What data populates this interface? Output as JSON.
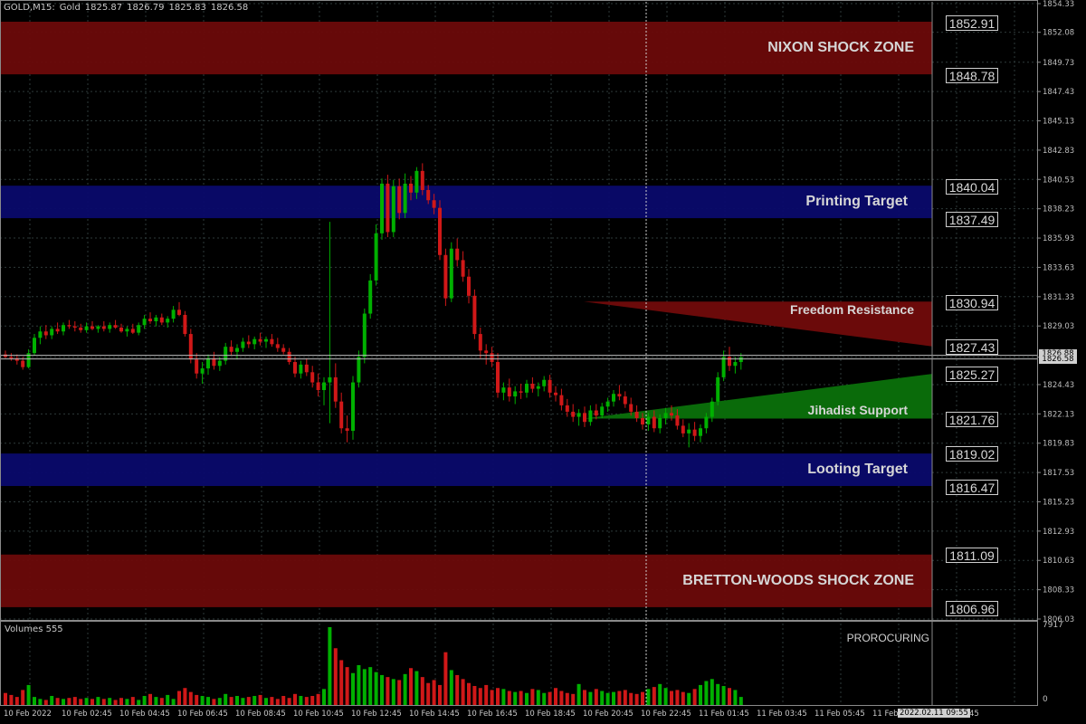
{
  "header": {
    "symbol": "GOLD,M15:",
    "name": "Gold",
    "open": "1825.87",
    "high": "1826.79",
    "low": "1825.83",
    "close": "1826.58"
  },
  "colors": {
    "background": "#000000",
    "grid": "#2e3a3a",
    "bull": "#00b000",
    "bear": "#d01818",
    "red_zone": "#6b0a0a",
    "blue_zone": "#0a0a6b",
    "green_wedge": "#0a6b0a"
  },
  "price_axis": {
    "ticks": [
      "1854.33",
      "1852.08",
      "1849.73",
      "1847.43",
      "1845.13",
      "1842.83",
      "1840.53",
      "1838.23",
      "1835.93",
      "1833.63",
      "1831.33",
      "1829.03",
      "1826.58",
      "1824.43",
      "1822.13",
      "1819.83",
      "1817.53",
      "1815.23",
      "1812.93",
      "1810.63",
      "1808.33",
      "1806.03"
    ],
    "current_price": "1826.58",
    "current_price_hidden": "1826.88"
  },
  "zones": [
    {
      "label": "NIXON SHOCK ZONE",
      "top_level": "1852.91",
      "bottom_level": "1848.78",
      "color": "red"
    },
    {
      "label": "Printing Target",
      "top_level": "1840.04",
      "bottom_level": "1837.49",
      "color": "blue"
    },
    {
      "label": "Looting Target",
      "top_level": "1819.02",
      "bottom_level": "1816.47",
      "color": "blue"
    },
    {
      "label": "BRETTON-WOODS SHOCK ZONE",
      "top_level": "1811.09",
      "bottom_level": "1806.96",
      "color": "red"
    }
  ],
  "wedges": {
    "resistance": {
      "label": "Freedom Resistance",
      "top_level": "1830.94",
      "bottom_level": "1827.43"
    },
    "support": {
      "label": "Jihadist Support",
      "top_level": "1825.27",
      "bottom_level": "1821.76"
    }
  },
  "volume": {
    "title": "Volumes 555",
    "indicator_name": "PROROCURING",
    "max": "7917",
    "min": "0"
  },
  "time_axis": {
    "labels": [
      "10 Feb 2022",
      "10 Feb 02:45",
      "10 Feb 04:45",
      "10 Feb 06:45",
      "10 Feb 08:45",
      "10 Feb 10:45",
      "10 Feb 12:45",
      "10 Feb 14:45",
      "10 Feb 16:45",
      "10 Feb 18:45",
      "10 Feb 20:45",
      "10 Feb 22:45",
      "11 Feb 01:45",
      "11 Feb 03:45",
      "11 Feb 05:45",
      "11 Feb"
    ],
    "current_time": "2022.02.11 09:55",
    "tail": "45"
  },
  "chart_data": {
    "type": "candlestick",
    "symbol": "GOLD",
    "timeframe": "M15",
    "ylim": [
      1806.03,
      1854.33
    ],
    "candles": [
      [
        1826.8,
        1827.1,
        1826.5,
        1826.6
      ],
      [
        1826.6,
        1826.9,
        1826.3,
        1826.5
      ],
      [
        1826.5,
        1826.8,
        1826.0,
        1826.3
      ],
      [
        1826.3,
        1826.6,
        1825.6,
        1825.8
      ],
      [
        1825.8,
        1827.2,
        1825.7,
        1826.9
      ],
      [
        1826.9,
        1828.4,
        1826.7,
        1828.1
      ],
      [
        1828.1,
        1829.0,
        1827.6,
        1828.6
      ],
      [
        1828.6,
        1829.1,
        1828.0,
        1828.3
      ],
      [
        1828.3,
        1829.0,
        1828.0,
        1828.8
      ],
      [
        1828.8,
        1829.3,
        1828.4,
        1828.6
      ],
      [
        1828.6,
        1829.3,
        1828.3,
        1829.1
      ],
      [
        1829.1,
        1829.5,
        1828.8,
        1829.0
      ],
      [
        1829.0,
        1829.4,
        1828.6,
        1828.9
      ],
      [
        1828.9,
        1829.2,
        1828.5,
        1828.7
      ],
      [
        1828.7,
        1829.3,
        1828.5,
        1829.0
      ],
      [
        1829.0,
        1829.4,
        1828.7,
        1828.8
      ],
      [
        1828.8,
        1829.1,
        1828.5,
        1829.0
      ],
      [
        1829.0,
        1829.4,
        1828.6,
        1828.8
      ],
      [
        1828.8,
        1829.3,
        1828.5,
        1829.1
      ],
      [
        1829.1,
        1829.5,
        1828.8,
        1828.9
      ],
      [
        1828.9,
        1829.2,
        1828.5,
        1828.6
      ],
      [
        1828.6,
        1829.0,
        1828.2,
        1828.8
      ],
      [
        1828.8,
        1829.2,
        1828.4,
        1828.5
      ],
      [
        1828.5,
        1829.3,
        1828.3,
        1829.1
      ],
      [
        1829.1,
        1829.9,
        1828.8,
        1829.6
      ],
      [
        1829.6,
        1830.1,
        1829.2,
        1829.4
      ],
      [
        1829.4,
        1829.9,
        1829.0,
        1829.7
      ],
      [
        1829.7,
        1830.0,
        1829.1,
        1829.3
      ],
      [
        1829.3,
        1829.8,
        1828.9,
        1829.6
      ],
      [
        1829.6,
        1830.6,
        1829.3,
        1830.3
      ],
      [
        1830.3,
        1830.9,
        1829.8,
        1829.9
      ],
      [
        1829.9,
        1830.2,
        1828.2,
        1828.4
      ],
      [
        1828.4,
        1828.8,
        1826.1,
        1826.4
      ],
      [
        1826.4,
        1826.9,
        1824.9,
        1825.3
      ],
      [
        1825.3,
        1826.2,
        1824.5,
        1825.7
      ],
      [
        1825.7,
        1826.8,
        1825.2,
        1826.5
      ],
      [
        1826.5,
        1827.0,
        1825.6,
        1825.9
      ],
      [
        1825.9,
        1826.6,
        1825.5,
        1826.3
      ],
      [
        1826.3,
        1827.7,
        1826.0,
        1827.4
      ],
      [
        1827.4,
        1827.9,
        1826.7,
        1827.0
      ],
      [
        1827.0,
        1827.6,
        1826.4,
        1827.3
      ],
      [
        1827.3,
        1828.1,
        1827.0,
        1827.8
      ],
      [
        1827.8,
        1828.3,
        1827.3,
        1827.6
      ],
      [
        1827.6,
        1828.2,
        1827.2,
        1828.0
      ],
      [
        1828.0,
        1828.5,
        1827.5,
        1827.8
      ],
      [
        1827.8,
        1828.2,
        1827.3,
        1828.0
      ],
      [
        1828.0,
        1828.4,
        1827.4,
        1827.6
      ],
      [
        1827.6,
        1828.1,
        1827.0,
        1827.3
      ],
      [
        1827.3,
        1827.6,
        1826.8,
        1827.0
      ],
      [
        1827.0,
        1827.3,
        1826.0,
        1826.2
      ],
      [
        1826.2,
        1826.6,
        1825.0,
        1825.3
      ],
      [
        1825.3,
        1826.3,
        1824.9,
        1826.0
      ],
      [
        1826.0,
        1826.5,
        1825.1,
        1825.4
      ],
      [
        1825.4,
        1825.9,
        1824.2,
        1824.6
      ],
      [
        1824.6,
        1825.3,
        1823.5,
        1824.0
      ],
      [
        1824.0,
        1825.0,
        1822.8,
        1824.6
      ],
      [
        1824.6,
        1837.2,
        1821.4,
        1825.0
      ],
      [
        1825.0,
        1826.1,
        1822.6,
        1823.1
      ],
      [
        1823.1,
        1823.8,
        1820.6,
        1821.0
      ],
      [
        1821.0,
        1822.0,
        1819.9,
        1820.8
      ],
      [
        1820.8,
        1825.1,
        1820.1,
        1824.6
      ],
      [
        1824.6,
        1827.1,
        1824.2,
        1826.6
      ],
      [
        1826.6,
        1830.4,
        1826.1,
        1830.0
      ],
      [
        1830.0,
        1833.1,
        1829.6,
        1832.6
      ],
      [
        1832.6,
        1837.0,
        1832.2,
        1836.3
      ],
      [
        1836.3,
        1840.6,
        1835.8,
        1840.2
      ],
      [
        1840.2,
        1840.9,
        1836.0,
        1836.4
      ],
      [
        1836.4,
        1840.5,
        1836.0,
        1840.0
      ],
      [
        1840.0,
        1840.6,
        1837.4,
        1837.9
      ],
      [
        1837.9,
        1841.0,
        1837.5,
        1840.2
      ],
      [
        1840.2,
        1840.8,
        1838.9,
        1839.5
      ],
      [
        1839.5,
        1841.5,
        1839.0,
        1841.2
      ],
      [
        1841.2,
        1841.8,
        1839.3,
        1839.7
      ],
      [
        1839.7,
        1840.1,
        1838.6,
        1838.9
      ],
      [
        1838.9,
        1839.4,
        1837.8,
        1838.3
      ],
      [
        1838.3,
        1838.9,
        1834.2,
        1834.6
      ],
      [
        1834.6,
        1835.1,
        1830.6,
        1831.2
      ],
      [
        1831.2,
        1835.6,
        1830.9,
        1835.1
      ],
      [
        1835.1,
        1835.9,
        1833.7,
        1834.2
      ],
      [
        1834.2,
        1834.9,
        1832.5,
        1832.9
      ],
      [
        1832.9,
        1833.5,
        1830.8,
        1831.4
      ],
      [
        1831.4,
        1831.9,
        1828.0,
        1828.4
      ],
      [
        1828.4,
        1828.9,
        1826.5,
        1827.1
      ],
      [
        1827.1,
        1827.6,
        1826.0,
        1826.9
      ],
      [
        1826.9,
        1827.4,
        1825.8,
        1826.2
      ],
      [
        1826.2,
        1826.9,
        1823.4,
        1823.8
      ],
      [
        1823.8,
        1824.6,
        1823.2,
        1824.2
      ],
      [
        1824.2,
        1824.9,
        1823.1,
        1823.5
      ],
      [
        1823.5,
        1824.3,
        1822.9,
        1823.9
      ],
      [
        1823.9,
        1824.5,
        1823.3,
        1823.8
      ],
      [
        1823.8,
        1824.8,
        1823.4,
        1824.5
      ],
      [
        1824.5,
        1825.0,
        1823.8,
        1824.1
      ],
      [
        1824.1,
        1824.6,
        1823.5,
        1824.3
      ],
      [
        1824.3,
        1825.1,
        1823.9,
        1824.8
      ],
      [
        1824.8,
        1825.2,
        1823.4,
        1823.8
      ],
      [
        1823.8,
        1824.3,
        1823.1,
        1823.6
      ],
      [
        1823.6,
        1824.1,
        1822.4,
        1822.8
      ],
      [
        1822.8,
        1823.3,
        1821.9,
        1822.3
      ],
      [
        1822.3,
        1822.9,
        1821.5,
        1821.9
      ],
      [
        1821.9,
        1822.5,
        1821.2,
        1822.2
      ],
      [
        1822.2,
        1822.7,
        1821.1,
        1821.5
      ],
      [
        1821.5,
        1822.8,
        1821.2,
        1822.4
      ],
      [
        1822.4,
        1822.9,
        1821.7,
        1822.0
      ],
      [
        1822.0,
        1823.0,
        1821.8,
        1822.7
      ],
      [
        1822.7,
        1823.4,
        1822.3,
        1823.1
      ],
      [
        1823.1,
        1824.0,
        1822.7,
        1823.7
      ],
      [
        1823.7,
        1824.4,
        1823.2,
        1823.5
      ],
      [
        1823.5,
        1823.9,
        1822.6,
        1822.9
      ],
      [
        1822.9,
        1823.4,
        1822.0,
        1822.3
      ],
      [
        1822.3,
        1822.8,
        1821.5,
        1821.8
      ],
      [
        1821.8,
        1822.2,
        1820.9,
        1821.3
      ],
      [
        1821.3,
        1822.2,
        1820.8,
        1821.9
      ],
      [
        1821.9,
        1822.4,
        1820.7,
        1821.0
      ],
      [
        1821.0,
        1822.1,
        1820.6,
        1821.8
      ],
      [
        1821.8,
        1822.6,
        1821.3,
        1822.2
      ],
      [
        1822.2,
        1822.8,
        1821.6,
        1822.0
      ],
      [
        1822.0,
        1822.5,
        1820.9,
        1821.2
      ],
      [
        1821.2,
        1821.7,
        1820.3,
        1820.6
      ],
      [
        1820.6,
        1821.4,
        1819.5,
        1820.9
      ],
      [
        1820.9,
        1821.5,
        1820.0,
        1820.4
      ],
      [
        1820.4,
        1821.3,
        1819.9,
        1821.0
      ],
      [
        1821.0,
        1822.2,
        1820.6,
        1821.9
      ],
      [
        1821.9,
        1823.4,
        1821.5,
        1823.1
      ],
      [
        1823.1,
        1825.4,
        1822.8,
        1825.0
      ],
      [
        1825.0,
        1827.1,
        1824.7,
        1826.6
      ],
      [
        1826.6,
        1827.4,
        1825.5,
        1825.9
      ],
      [
        1825.9,
        1826.6,
        1825.3,
        1826.2
      ],
      [
        1826.2,
        1826.9,
        1825.6,
        1826.58
      ]
    ],
    "volumes": [
      1300,
      1100,
      900,
      1600,
      2100,
      900,
      700,
      600,
      1000,
      800,
      700,
      800,
      900,
      700,
      800,
      700,
      900,
      700,
      800,
      600,
      800,
      700,
      900,
      600,
      1000,
      1200,
      900,
      800,
      1100,
      700,
      1500,
      1800,
      1400,
      1100,
      1000,
      900,
      700,
      800,
      1200,
      900,
      1000,
      800,
      900,
      1000,
      1100,
      800,
      900,
      700,
      1000,
      800,
      1200,
      1000,
      900,
      1000,
      1200,
      1700,
      7917,
      5800,
      4600,
      3900,
      3300,
      4100,
      3700,
      3900,
      3400,
      3100,
      2900,
      2700,
      2600,
      3200,
      3800,
      3500,
      2900,
      2300,
      2600,
      2100,
      5400,
      3600,
      3100,
      2700,
      2300,
      2000,
      1800,
      2100,
      1600,
      1800,
      1700,
      1500,
      1400,
      1500,
      1300,
      1700,
      1600,
      1300,
      1400,
      1800,
      1500,
      1300,
      1200,
      2200,
      1600,
      1400,
      1700,
      1500,
      1300,
      1400,
      1500,
      1600,
      1300,
      1200,
      1400,
      1700,
      1900,
      2200,
      1800,
      1500,
      1600,
      1400,
      1300,
      1700,
      2100,
      2500,
      2700,
      2200,
      2000,
      1800,
      1600,
      900
    ]
  }
}
